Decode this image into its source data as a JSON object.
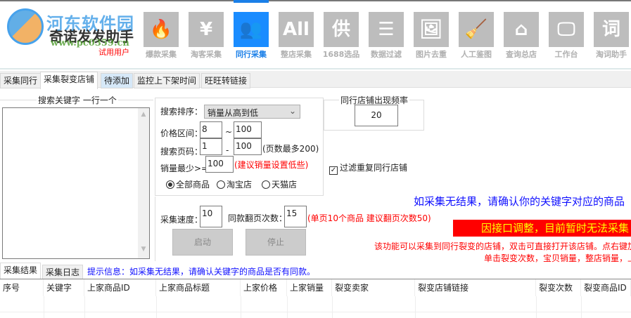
{
  "app": {
    "title": "奇诺发发助手",
    "user_status": "试用用户",
    "watermark_name": "河东软件园",
    "watermark_url": "www.pc0359.cn"
  },
  "nav": [
    {
      "label": "爆款采集",
      "icon": "flame-icon",
      "glyph": "🔥"
    },
    {
      "label": "淘客采集",
      "icon": "yen-icon",
      "glyph": "¥"
    },
    {
      "label": "同行采集",
      "icon": "users-icon",
      "glyph": "👥",
      "active": true
    },
    {
      "label": "整店采集",
      "icon": "all-icon",
      "glyph": "All"
    },
    {
      "label": "1688选品",
      "icon": "supply-icon",
      "glyph": "供"
    },
    {
      "label": "数据过滤",
      "icon": "filter-search-icon",
      "glyph": "☰"
    },
    {
      "label": "图片去重",
      "icon": "image-icon",
      "glyph": "🖼"
    },
    {
      "label": "人工鉴图",
      "icon": "sweeper-icon",
      "glyph": "🧹"
    },
    {
      "label": "查询总店",
      "icon": "house-chart-icon",
      "glyph": "⌂"
    },
    {
      "label": "工作台",
      "icon": "monitor-icon",
      "glyph": "🖵"
    },
    {
      "label": "淘词助手",
      "icon": "word-search-icon",
      "glyph": "词"
    }
  ],
  "tabs": [
    "采集同行",
    "采集裂变店铺",
    "待添加",
    "监控上下架时间",
    "旺旺转链接"
  ],
  "keywords": {
    "label": "搜索关键字 一行一个",
    "value": ""
  },
  "search": {
    "sort_label": "搜索排序：",
    "sort_value": "销量从高到低",
    "price_label": "价格区间：",
    "price_min": "8",
    "price_sep": "~",
    "price_max": "100",
    "page_label": "搜索页码：",
    "page_min": "1",
    "page_sep": "-",
    "page_max": "100",
    "page_note": "(页数最多200)",
    "sales_label": "销量最少>=",
    "sales_min": "100",
    "sales_note": "(建议销量设置低些)",
    "radios": [
      "全部商品",
      "淘宝店",
      "天猫店"
    ]
  },
  "frequency": {
    "label": "同行店铺出现频率",
    "value": "20"
  },
  "filter_dup": {
    "label": "过滤重复同行店铺",
    "checked": true
  },
  "notice_blue": "如采集无结果，请确认你的关键字对应的商品",
  "speed": {
    "label": "采集速度：",
    "value": "10",
    "pages_label": "同款翻页次数：",
    "pages_value": "15",
    "note": "(单页10个商品 建议翻页次数50)"
  },
  "buttons": {
    "start": "启动",
    "stop": "停止"
  },
  "banner": "因接口调整，目前暂时无法采集",
  "info_red_1": "该功能可以采集到同行裂变的店铺，双击可直接打开该店铺。点右键加",
  "info_red_2": "单击裂变次数，宝贝销量，整店销量，上",
  "bottom_tabs": [
    "采集结果",
    "采集日志"
  ],
  "hint": "提示信息：如采集无结果，请确认关键字的商品是否有同款。",
  "table": {
    "columns": [
      "序号",
      "关键字",
      "上家商品ID",
      "上家商品标题",
      "上家价格",
      "上家销量",
      "裂变卖家",
      "裂变店铺链接",
      "裂变次数",
      "裂变商品ID"
    ],
    "rows": []
  },
  "colors": {
    "accent": "#1a8cff",
    "banner_bg": "#ff0000",
    "banner_text": "#ffff00"
  }
}
